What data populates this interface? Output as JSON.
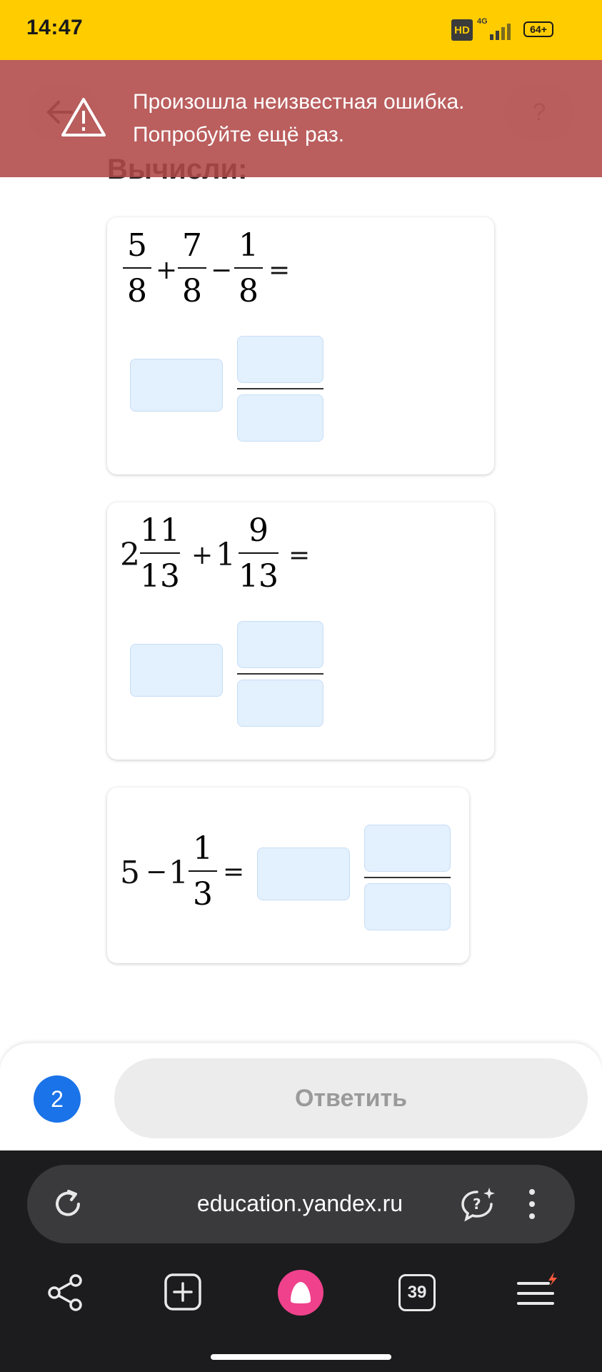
{
  "status_bar": {
    "time": "14:47",
    "hd": "HD",
    "network": "4G",
    "battery": "64+"
  },
  "header": {
    "title": "Вычисли:",
    "help": "?"
  },
  "error": {
    "line1": "Произошла неизвестная ошибка.",
    "line2": "Попробуйте ещё раз."
  },
  "tasks": [
    {
      "expr": [
        {
          "num": "5",
          "den": "8"
        },
        {
          "op": "+"
        },
        {
          "num": "7",
          "den": "8"
        },
        {
          "op": "−"
        },
        {
          "num": "1",
          "den": "8"
        },
        {
          "op": "="
        }
      ]
    },
    {
      "expr": [
        {
          "whole": "2",
          "num": "11",
          "den": "13"
        },
        {
          "op": "+"
        },
        {
          "whole": "1",
          "num": "9",
          "den": "13"
        },
        {
          "op": "="
        }
      ]
    },
    {
      "expr": [
        {
          "whole": "5"
        },
        {
          "op": "−"
        },
        {
          "whole": "1",
          "num": "1",
          "den": "3"
        },
        {
          "op": "="
        }
      ]
    }
  ],
  "footer": {
    "counter": "2",
    "answer_label": "Ответить"
  },
  "browser": {
    "url": "education.yandex.ru",
    "tabs_count": "39"
  },
  "colors": {
    "status": "#ffcc00",
    "error": "#b04848",
    "input": "#e3f0fd",
    "accent": "#1a73e8"
  }
}
